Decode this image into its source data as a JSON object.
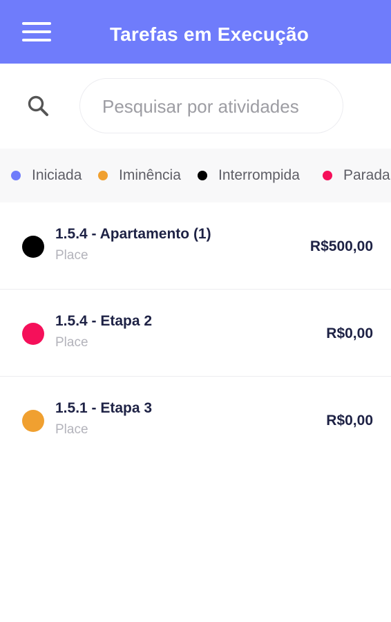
{
  "header": {
    "title": "Tarefas em Execução",
    "menu_icon": "hamburger-menu-icon",
    "background_color": "#6f7cfb"
  },
  "search": {
    "icon": "search-icon",
    "placeholder": "Pesquisar por atividades",
    "value": ""
  },
  "legend": [
    {
      "label": "Iniciada",
      "color": "#6f7cfb"
    },
    {
      "label": "Iminência",
      "color": "#f0a030"
    },
    {
      "label": "Interrompida",
      "color": "#000000"
    },
    {
      "label": "Parada",
      "color": "#f5105a"
    }
  ],
  "tasks": [
    {
      "name": "1.5.4 - Apartamento (1)",
      "place": "Place",
      "price": "R$500,00",
      "status_color": "#000000"
    },
    {
      "name": "1.5.4 - Etapa 2",
      "place": "Place",
      "price": "R$0,00",
      "status_color": "#f5105a"
    },
    {
      "name": "1.5.1 - Etapa 3",
      "place": "Place",
      "price": "R$0,00",
      "status_color": "#f0a030"
    }
  ]
}
